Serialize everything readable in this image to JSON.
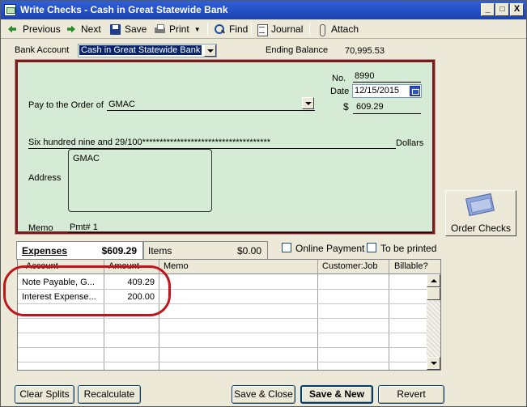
{
  "window": {
    "title": "Write Checks - Cash in Great Statewide Bank",
    "minimize": "_",
    "maximize": "□",
    "close": "X"
  },
  "toolbar": {
    "previous": "Previous",
    "next": "Next",
    "save": "Save",
    "print": "Print",
    "find": "Find",
    "journal": "Journal",
    "attach": "Attach"
  },
  "account": {
    "label": "Bank Account",
    "value": "Cash in Great Statewide Bank",
    "ending_balance_label": "Ending Balance",
    "ending_balance": "70,995.53"
  },
  "check": {
    "no_label": "No.",
    "no": "8990",
    "date_label": "Date",
    "date": "12/15/2015",
    "pay_to_label": "Pay to the Order of",
    "payee": "GMAC",
    "dollar_sign": "$",
    "amount": "609.29",
    "written_amount": "Six hundred nine and 29/100*************************************",
    "dollars_label": "Dollars",
    "address_label": "Address",
    "address": "GMAC",
    "memo_label": "Memo",
    "memo": "Pmt# 1"
  },
  "order_checks": {
    "label": "Order Checks"
  },
  "tabs": {
    "expenses_label": "Expenses",
    "expenses_amount": "$609.29",
    "items_label": "Items",
    "items_amount": "$0.00"
  },
  "options": {
    "online_payment": "Online Payment",
    "to_be_printed": "To be printed",
    "online_payment_checked": false,
    "to_be_printed_checked": false
  },
  "grid": {
    "columns": [
      "Account",
      "Amount",
      "Memo",
      "Customer:Job",
      "Billable?"
    ],
    "rows": [
      {
        "account": "Note Payable, G...",
        "amount": "409.29",
        "memo": "",
        "customer_job": "",
        "billable": ""
      },
      {
        "account": "Interest Expense...",
        "amount": "200.00",
        "memo": "",
        "customer_job": "",
        "billable": ""
      }
    ]
  },
  "buttons": {
    "clear_splits": "Clear Splits",
    "recalculate": "Recalculate",
    "save_close": "Save & Close",
    "save_new": "Save & New",
    "revert": "Revert"
  },
  "colors": {
    "check_background": "#d5ebd5",
    "check_border": "#7a1b1b",
    "highlight_circle": "#c0141c",
    "title_bar": "#2f5fd8"
  }
}
